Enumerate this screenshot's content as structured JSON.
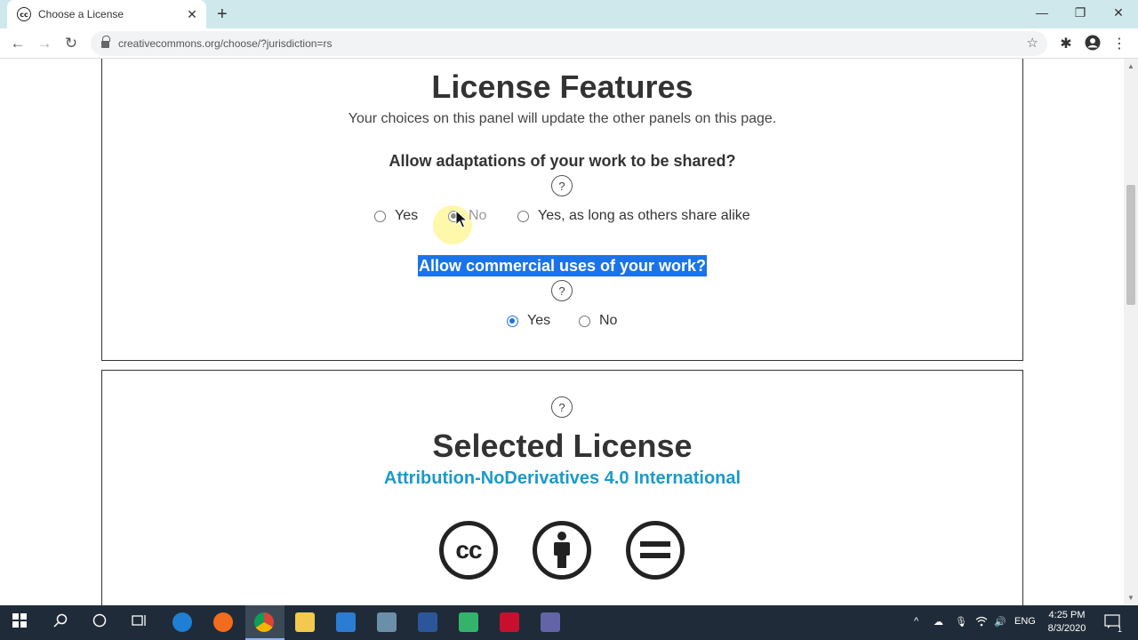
{
  "browser": {
    "tab_title": "Choose a License",
    "tab_favicon_text": "cc",
    "url": "creativecommons.org/choose/?jurisdiction=rs"
  },
  "license_features": {
    "title": "License Features",
    "subtitle": "Your choices on this panel will update the other panels on this page.",
    "adaptations": {
      "question": "Allow adaptations of your work to be shared?",
      "options": [
        {
          "label": "Yes",
          "selected": false
        },
        {
          "label": "No",
          "selected": true
        },
        {
          "label": "Yes, as long as others share alike",
          "selected": false
        }
      ]
    },
    "commercial": {
      "question": "Allow commercial uses of your work?",
      "options": [
        {
          "label": "Yes",
          "selected": true
        },
        {
          "label": "No",
          "selected": false
        }
      ]
    }
  },
  "selected_license": {
    "title": "Selected License",
    "name": "Attribution-NoDerivatives 4.0 International",
    "icons": [
      "cc-icon",
      "attribution-icon",
      "no-derivatives-icon"
    ],
    "cc_text": "cc"
  },
  "taskbar": {
    "time": "4:25 PM",
    "date": "8/3/2020",
    "language": "ENG",
    "notifications": "1"
  },
  "colors": {
    "accent": "#1a73e8",
    "license_link": "#1b9ac9",
    "taskbar": "#1f2b38",
    "titlebar": "#cfe8ec"
  }
}
